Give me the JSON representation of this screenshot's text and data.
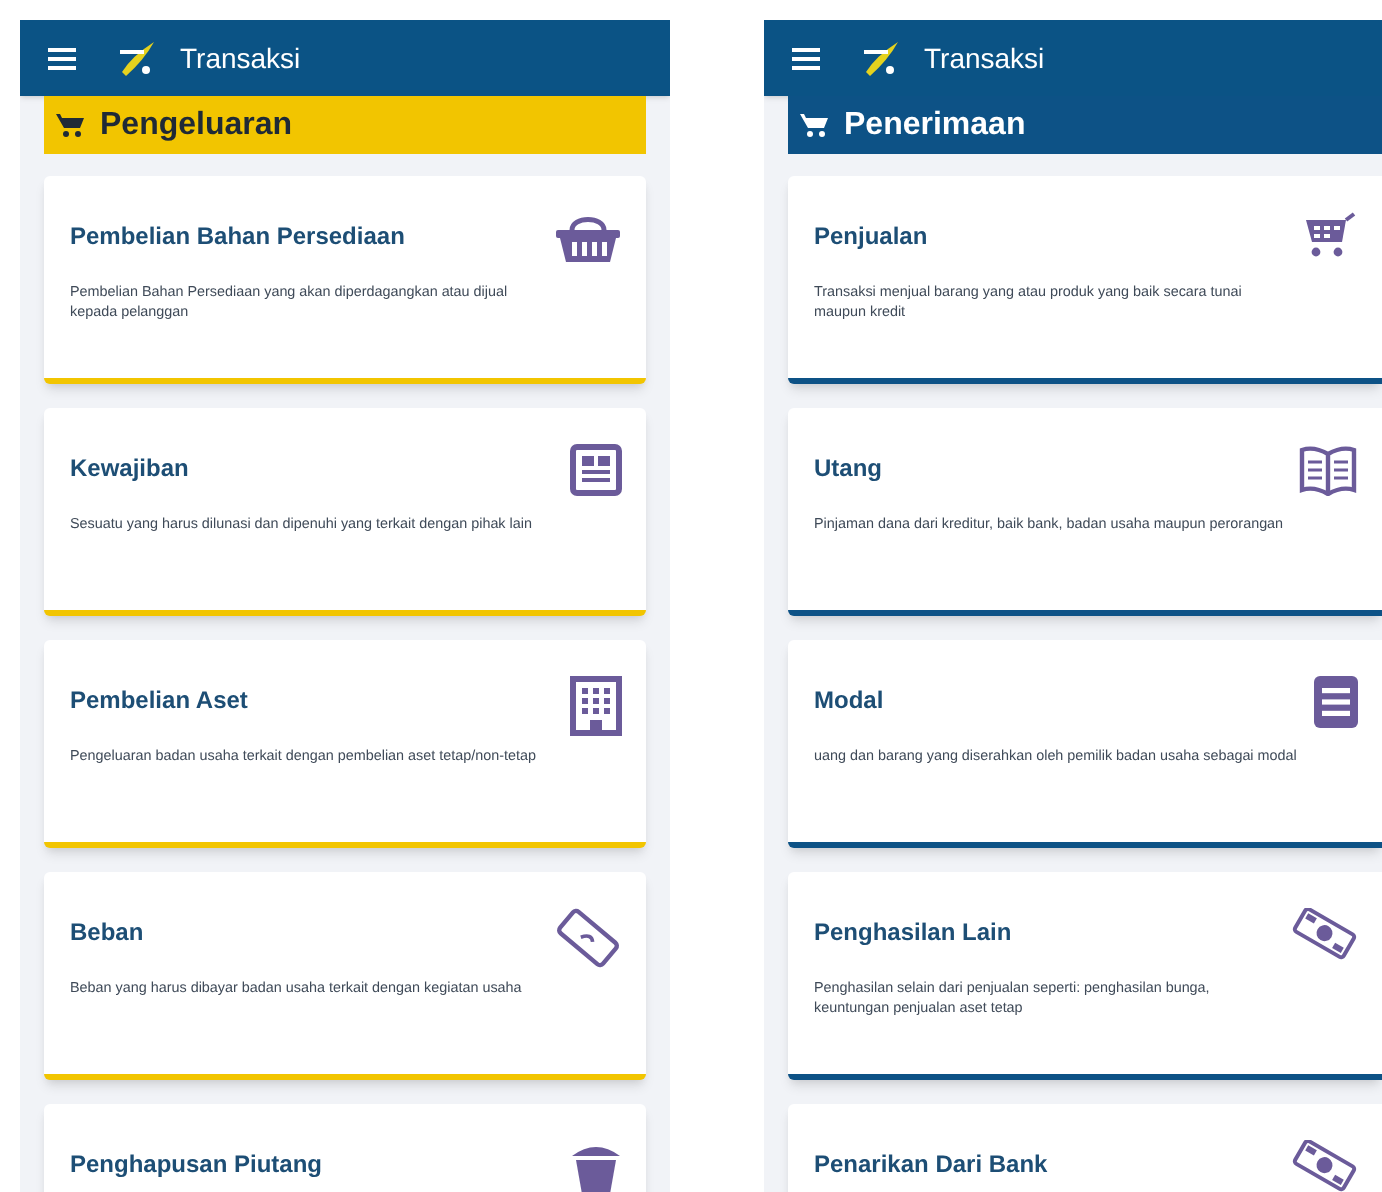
{
  "screens": [
    {
      "app_bar": {
        "title": "Transaksi"
      },
      "section": {
        "title": "Pengeluaran",
        "color": "#f2c500"
      },
      "cards": [
        {
          "title": "Pembelian Bahan Persediaan",
          "description": "Pembelian Bahan Persediaan yang akan diperdagangkan atau dijual kepada pelanggan"
        },
        {
          "title": "Kewajiban",
          "description": "Sesuatu yang harus dilunasi dan dipenuhi yang terkait dengan pihak lain"
        },
        {
          "title": "Pembelian Aset",
          "description": "Pengeluaran badan usaha terkait dengan pembelian aset tetap/non-tetap"
        },
        {
          "title": "Beban",
          "description": "Beban yang harus dibayar badan usaha terkait dengan kegiatan usaha"
        },
        {
          "title": "Penghapusan Piutang"
        }
      ]
    },
    {
      "app_bar": {
        "title": "Transaksi"
      },
      "section": {
        "title": "Penerimaan",
        "color": "#0d5286"
      },
      "cards": [
        {
          "title": "Penjualan",
          "description": "Transaksi menjual barang yang atau produk yang baik secara tunai maupun kredit"
        },
        {
          "title": "Utang",
          "description": "Pinjaman dana dari kreditur, baik bank, badan usaha maupun perorangan"
        },
        {
          "title": "Modal",
          "description": "uang dan barang yang diserahkan oleh pemilik badan usaha sebagai modal"
        },
        {
          "title": "Penghasilan Lain",
          "description": "Penghasilan selain dari penjualan seperti: penghasilan bunga, keuntungan penjualan aset tetap"
        },
        {
          "title": "Penarikan Dari Bank"
        }
      ]
    }
  ]
}
